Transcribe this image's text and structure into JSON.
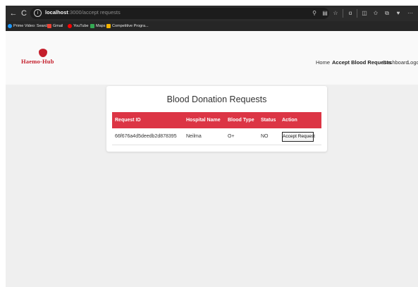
{
  "browser": {
    "url_host": "localhost",
    "url_path": ":3000/accept requests",
    "nav": {
      "back": "←",
      "reload": "C",
      "info": "i"
    },
    "toolbar_icons": [
      "search-icon",
      "reader-icon",
      "favorite-icon",
      "copilot-icon",
      "split-screen-icon",
      "favorites-icon",
      "collections-icon",
      "extension-icon",
      "more-icon"
    ],
    "bookmarks": [
      {
        "label": "Prime Video: Search",
        "color": "#1a98ff"
      },
      {
        "label": "Gmail",
        "color": "#ea4335"
      },
      {
        "label": "YouTube",
        "color": "#ff0000"
      },
      {
        "label": "Maps",
        "color": "#34a853"
      },
      {
        "label": "Competitive Progra...",
        "color": "#f5b400"
      }
    ]
  },
  "header": {
    "logo_text": "Haemo-Hub",
    "nav": [
      {
        "label": "Home",
        "active": false
      },
      {
        "label": "Accept Blood Requests",
        "active": true
      },
      {
        "label": "Dashboard",
        "active": false
      },
      {
        "label": "Logo",
        "active": false
      }
    ]
  },
  "requests": {
    "title": "Blood Donation Requests",
    "columns": [
      "Request ID",
      "Hospital Name",
      "Blood Type",
      "Status",
      "Action"
    ],
    "rows": [
      {
        "request_id": "66f676a4d5deedb2d878395",
        "hospital_name": "Neilma",
        "blood_type": "O+",
        "status": "NO",
        "action_label": "Accept Request"
      }
    ]
  },
  "colors": {
    "accent": "#dc3545",
    "brand": "#c41e2b"
  }
}
